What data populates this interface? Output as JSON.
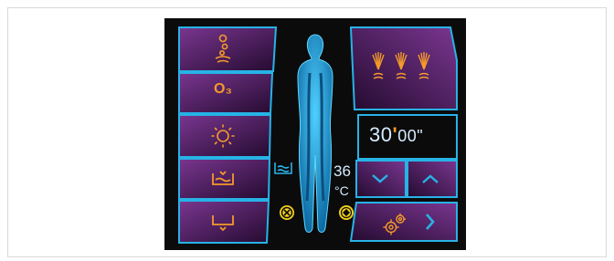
{
  "left_panel": {
    "buttons": [
      {
        "name": "bubbles-button",
        "icon": "bubbles-icon",
        "label": ""
      },
      {
        "name": "ozone-button",
        "icon": "ozone-icon",
        "label": "O₃"
      },
      {
        "name": "light-button",
        "icon": "sun-icon",
        "label": ""
      },
      {
        "name": "bath-fill-button",
        "icon": "bath-fill-icon",
        "label": ""
      },
      {
        "name": "drain-button",
        "icon": "drain-icon",
        "label": ""
      }
    ]
  },
  "center": {
    "water_temp_value": "36",
    "water_temp_unit": "°C",
    "water_level_icon": "water-level-icon",
    "stop_icon": "stop-x-icon",
    "auto_icon": "diamond-icon"
  },
  "right_panel": {
    "jets_icon": "jets-icon",
    "timer_text": "30ʹ00ʺ",
    "timer_minutes": "30",
    "timer_min_mark": "ʹ",
    "timer_seconds": "00",
    "timer_sec_mark": "ʺ",
    "down_icon": "chevron-down-icon",
    "up_icon": "chevron-up-icon",
    "settings_icon": "gears-icon",
    "next_icon": "chevron-right-icon"
  },
  "colors": {
    "accent_cyan": "#27b3e6",
    "panel_purple_dark": "#2a0f3a",
    "panel_purple_light": "#6c2e80",
    "orange": "#f59a2a",
    "yellow": "#f5d21a",
    "text_light": "#d6ecff"
  }
}
